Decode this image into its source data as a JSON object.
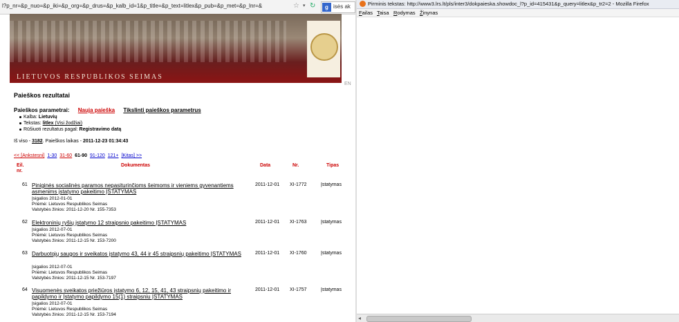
{
  "left": {
    "url": "l?p_nr=&p_nuo=&p_iki=&p_org=&p_drus=&p_kalb_id=1&p_title=&p_text=litlex&p_pub=&p_met=&p_lnr=&",
    "search_text": "isės ak",
    "banner_title": "LIETUVOS RESPUBLIKOS SEIMAS",
    "lang_link": "EN",
    "heading": "Paieškos rezultatai",
    "params_label": "Paieškos parametrai:",
    "new_search": "Nauja paieška",
    "refine_search": "Tikslinti paieškos parametrus",
    "bullets": [
      {
        "label": "Kalba: ",
        "value": "Lietuvių"
      },
      {
        "label": "Tekstas: ",
        "value": "litlex",
        "extra": " (Visi žodžiai)"
      },
      {
        "label": "Rūšiuoti rezultatus pagal: ",
        "value": "Registravimo datą"
      }
    ],
    "summary": {
      "prefix": "Iš viso - ",
      "count": "3182",
      "middle": ". Paieškos laikas - ",
      "time": "2011-12-23 01:34:43"
    },
    "pager": {
      "prev": "<< [Ankstesni]",
      "p1": "1-30",
      "p2": "31-60",
      "current": "61-90",
      "p4": "91-120",
      "p5": "121+",
      "next": "[Kitas] >>"
    },
    "table_headers": {
      "nr": "Eil. nr.",
      "doc": "Dokumentas",
      "date": "Data",
      "no": "Nr.",
      "type": "Tipas"
    },
    "rows": [
      {
        "n": "61",
        "title": "Piniginės socialinės paramos nepasiturinčioms šeimoms ir vieniems gyvenantiems asmenims įstatymo pakeitimo ĮSTATYMAS",
        "meta": [
          "Įsigalios 2012-01-01",
          "Priėmė: Lietuvos Respublikos Seimas",
          "Valstybės žinios: 2011-12-20 Nr. 155-7353"
        ],
        "date": "2011-12-01",
        "no": "XI-1772",
        "type": "Įstatymas"
      },
      {
        "n": "62",
        "title": "Elektroninių ryšių įstatymo 12 straipsnio pakeitimo ĮSTATYMAS",
        "meta": [
          "Įsigalios 2012-07-01",
          "Priėmė: Lietuvos Respublikos Seimas",
          "Valstybės žinios: 2011-12-15 Nr. 153-7200"
        ],
        "date": "2011-12-01",
        "no": "XI-1763",
        "type": "Įstatymas"
      },
      {
        "n": "63",
        "title": "Darbuotojų saugos ir sveikatos įstatymo 43, 44 ir 45 straipsnių pakeitimo ĮSTATYMAS",
        "meta": [
          "Įsigalios 2012-07-01",
          "Priėmė: Lietuvos Respublikos Seimas",
          "Valstybės žinios: 2011-12-15 Nr. 153-7197"
        ],
        "date": "2011-12-01",
        "no": "XI-1760",
        "type": "Įstatymas"
      },
      {
        "n": "64",
        "title": "Visuomenės sveikatos priežiūros įstatymo 6, 12, 15, 41, 43 straipsnių pakeitimo ir papildymo ir Įstatymo papildymo 15(1) straipsniu ĮSTATYMAS",
        "meta": [
          "Įsigalios 2012-07-01",
          "Priėmė: Lietuvos Respublikos Seimas",
          "Valstybės žinios: 2011-12-15 Nr. 153-7194"
        ],
        "date": "2011-12-01",
        "no": "XI-1757",
        "type": "Įstatymas"
      }
    ]
  },
  "right": {
    "window_title": "Pirminis tekstas: http://www3.lrs.lt/pls/inter3/dokpaieska.showdoc_l?p_id=415431&p_query=litlex&p_tr2=2 - Mozilla Firefox",
    "menu": [
      "Failas",
      "Taisa",
      "Rodymas",
      "Žinynas"
    ]
  }
}
